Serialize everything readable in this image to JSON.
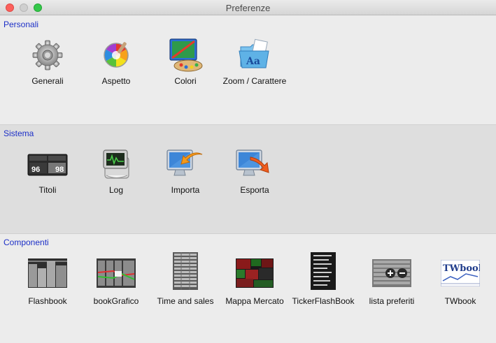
{
  "window": {
    "title": "Preferenze"
  },
  "sections": {
    "personali": {
      "title": "Personali",
      "items": [
        {
          "label": "Generali",
          "icon": "gear-icon"
        },
        {
          "label": "Aspetto",
          "icon": "color-wheel-icon"
        },
        {
          "label": "Colori",
          "icon": "paint-palette-icon"
        },
        {
          "label": "Zoom / Carattere",
          "icon": "font-folder-icon"
        }
      ]
    },
    "sistema": {
      "title": "Sistema",
      "items": [
        {
          "label": "Titoli",
          "icon": "ticker-quotes-icon",
          "quote_left": "96",
          "quote_right": "98"
        },
        {
          "label": "Log",
          "icon": "log-monitor-icon"
        },
        {
          "label": "Importa",
          "icon": "import-arrow-icon"
        },
        {
          "label": "Esporta",
          "icon": "export-arrow-icon"
        }
      ]
    },
    "componenti": {
      "title": "Componenti",
      "items": [
        {
          "label": "Flashbook",
          "icon": "flashbook-icon"
        },
        {
          "label": "bookGrafico",
          "icon": "book-chart-icon"
        },
        {
          "label": "Time and sales",
          "icon": "time-and-sales-icon"
        },
        {
          "label": "Mappa Mercato",
          "icon": "market-map-icon"
        },
        {
          "label": "TickerFlashBook",
          "icon": "ticker-flashbook-icon"
        },
        {
          "label": "lista preferiti",
          "icon": "favorites-list-icon"
        },
        {
          "label": "TWbook",
          "icon": "twbook-icon",
          "logo_text": "TWbook"
        }
      ]
    }
  }
}
